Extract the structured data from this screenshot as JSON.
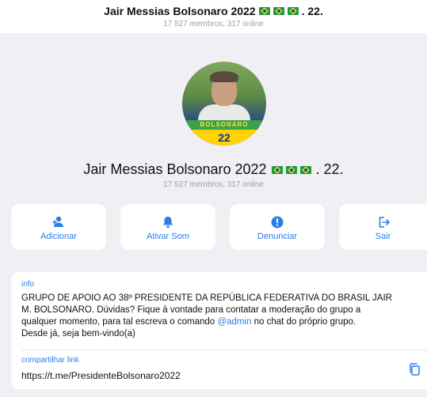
{
  "header": {
    "title": "Jair Messias Bolsonaro 2022",
    "title_suffix": ". 22.",
    "subtitle": "17 527 membros, 317 online"
  },
  "profile": {
    "avatar_banner": "BOLSONARO",
    "avatar_number": "22",
    "name": "Jair Messias Bolsonaro 2022",
    "name_suffix": ". 22.",
    "members": "17 527 membros, 317 online",
    "flag_icon": "brazil-flag-icon"
  },
  "actions": [
    {
      "label": "Adicionar",
      "icon": "add-user-icon"
    },
    {
      "label": "Ativar Som",
      "icon": "bell-icon"
    },
    {
      "label": "Denunciar",
      "icon": "report-icon"
    },
    {
      "label": "Sair",
      "icon": "exit-icon"
    }
  ],
  "info": {
    "title": "info",
    "desc_line1": "GRUPO DE APOIO AO 38º PRESIDENTE DA REPÚBLICA FEDERATIVA DO BRASIL JAIR",
    "desc_line2": "M. BOLSONARO. Dúvidas? Fique à vontade para contatar a moderação do grupo a",
    "desc_line3_a": "qualquer momento, para tal escreva o comando ",
    "mention": "@admin",
    "desc_line3_b": " no chat do próprio grupo.",
    "desc_line4": "Desde já, seja bem-vindo(a)",
    "link_label": "compartilhar link",
    "link_value": "https://t.me/PresidenteBolsonaro2022"
  },
  "colors": {
    "accent": "#2b7de9",
    "background": "#efeff4",
    "card": "#ffffff"
  }
}
